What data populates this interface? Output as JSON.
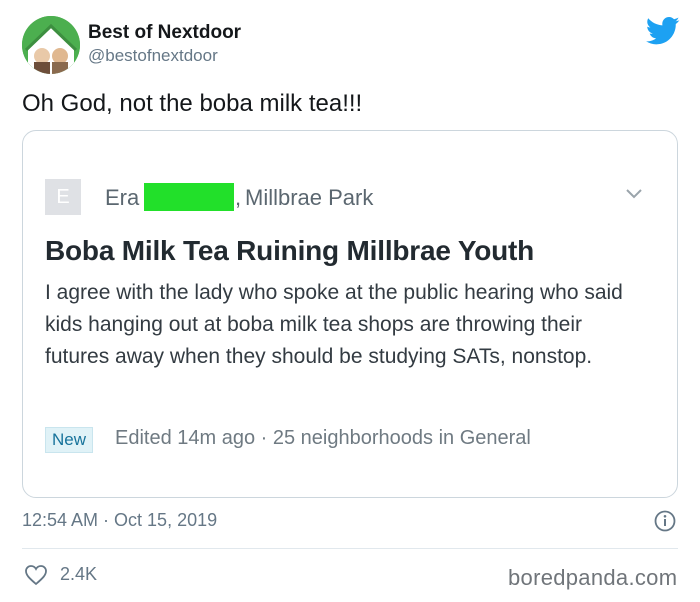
{
  "account": {
    "name": "Best of Nextdoor",
    "handle": "@bestofnextdoor"
  },
  "tweet": {
    "text": "Oh God, not the boba milk tea!!!",
    "timestamp": "12:54 AM · Oct 15, 2019",
    "likes": "2.4K"
  },
  "post": {
    "author_initial": "E",
    "author_name": "Era",
    "location_separator": ",",
    "location": "Millbrae Park",
    "title": "Boba Milk Tea Ruining Millbrae Youth",
    "body": "I agree with the lady who spoke at the public hearing who said kids hanging out at boba milk tea shops are throwing their futures away when they should be studying SATs, nonstop.",
    "badge": "New",
    "meta": "Edited 14m ago · 25 neighborhoods in General"
  },
  "watermark": "boredpanda.com",
  "colors": {
    "twitter_blue": "#1da1f2",
    "redaction_green": "#22e02a",
    "badge_text": "#17739b",
    "badge_bg": "#e0f2f7"
  },
  "icons": {
    "bird": "twitter-bird-icon",
    "chevron": "chevron-down-icon",
    "info": "info-icon",
    "heart": "heart-icon"
  }
}
